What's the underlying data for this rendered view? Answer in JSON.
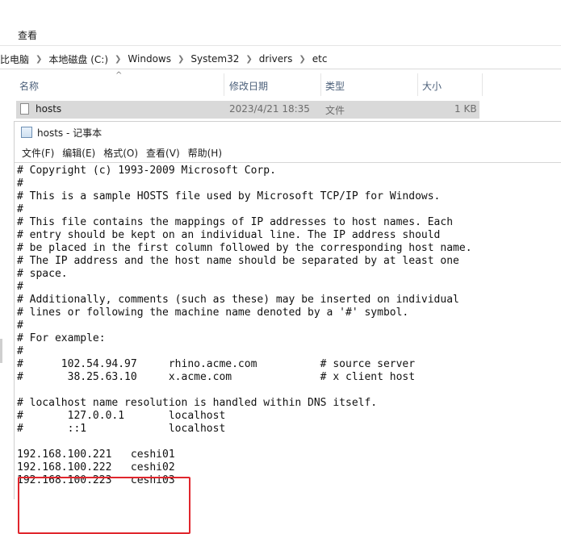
{
  "explorer": {
    "ribbon_tab": "查看",
    "breadcrumbs": [
      "比电脑",
      "本地磁盘 (C:)",
      "Windows",
      "System32",
      "drivers",
      "etc"
    ],
    "columns": [
      "名称",
      "修改日期",
      "类型",
      "大小"
    ],
    "files": [
      {
        "name": "hosts",
        "modified": "2023/4/21 18:35",
        "type": "文件",
        "size": "1 KB"
      }
    ]
  },
  "notepad": {
    "title": "hosts - 记事本",
    "menu": [
      "文件(F)",
      "编辑(E)",
      "格式(O)",
      "查看(V)",
      "帮助(H)"
    ],
    "content": "# Copyright (c) 1993-2009 Microsoft Corp.\n#\n# This is a sample HOSTS file used by Microsoft TCP/IP for Windows.\n#\n# This file contains the mappings of IP addresses to host names. Each\n# entry should be kept on an individual line. The IP address should\n# be placed in the first column followed by the corresponding host name.\n# The IP address and the host name should be separated by at least one\n# space.\n#\n# Additionally, comments (such as these) may be inserted on individual\n# lines or following the machine name denoted by a '#' symbol.\n#\n# For example:\n#\n#      102.54.94.97     rhino.acme.com          # source server\n#       38.25.63.10     x.acme.com              # x client host\n\n# localhost name resolution is handled within DNS itself.\n#\t127.0.0.1       localhost\n#\t::1             localhost\n\n192.168.100.221   ceshi01\n192.168.100.222   ceshi02\n192.168.100.223   ceshi03"
  },
  "colors": {
    "highlight": "#e0262d",
    "row_selected": "#d9d9d9"
  }
}
